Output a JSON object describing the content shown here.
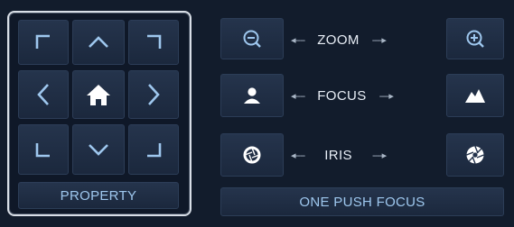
{
  "direction_pad": {
    "buttons": [
      {
        "name": "up-left-button",
        "icon": "corner-up-left-icon"
      },
      {
        "name": "up-button",
        "icon": "chevron-up-icon"
      },
      {
        "name": "up-right-button",
        "icon": "corner-up-right-icon"
      },
      {
        "name": "left-button",
        "icon": "chevron-left-icon"
      },
      {
        "name": "home-button",
        "icon": "home-icon"
      },
      {
        "name": "right-button",
        "icon": "chevron-right-icon"
      },
      {
        "name": "down-left-button",
        "icon": "corner-down-left-icon"
      },
      {
        "name": "down-button",
        "icon": "chevron-down-icon"
      },
      {
        "name": "down-right-button",
        "icon": "corner-down-right-icon"
      }
    ],
    "property_label": "PROPERTY"
  },
  "controls": {
    "zoom": {
      "label": "ZOOM",
      "left_icon": "zoom-out-icon",
      "right_icon": "zoom-in-icon"
    },
    "focus": {
      "label": "FOCUS",
      "left_icon": "person-icon",
      "right_icon": "mountain-icon"
    },
    "iris": {
      "label": "IRIS",
      "left_icon": "iris-open-icon",
      "right_icon": "iris-closed-icon"
    },
    "one_push_focus_label": "ONE PUSH FOCUS"
  },
  "colors": {
    "background": "#121c2c",
    "button": "#22314a",
    "icon": "#9ec7ee",
    "label": "#e8eef6"
  }
}
